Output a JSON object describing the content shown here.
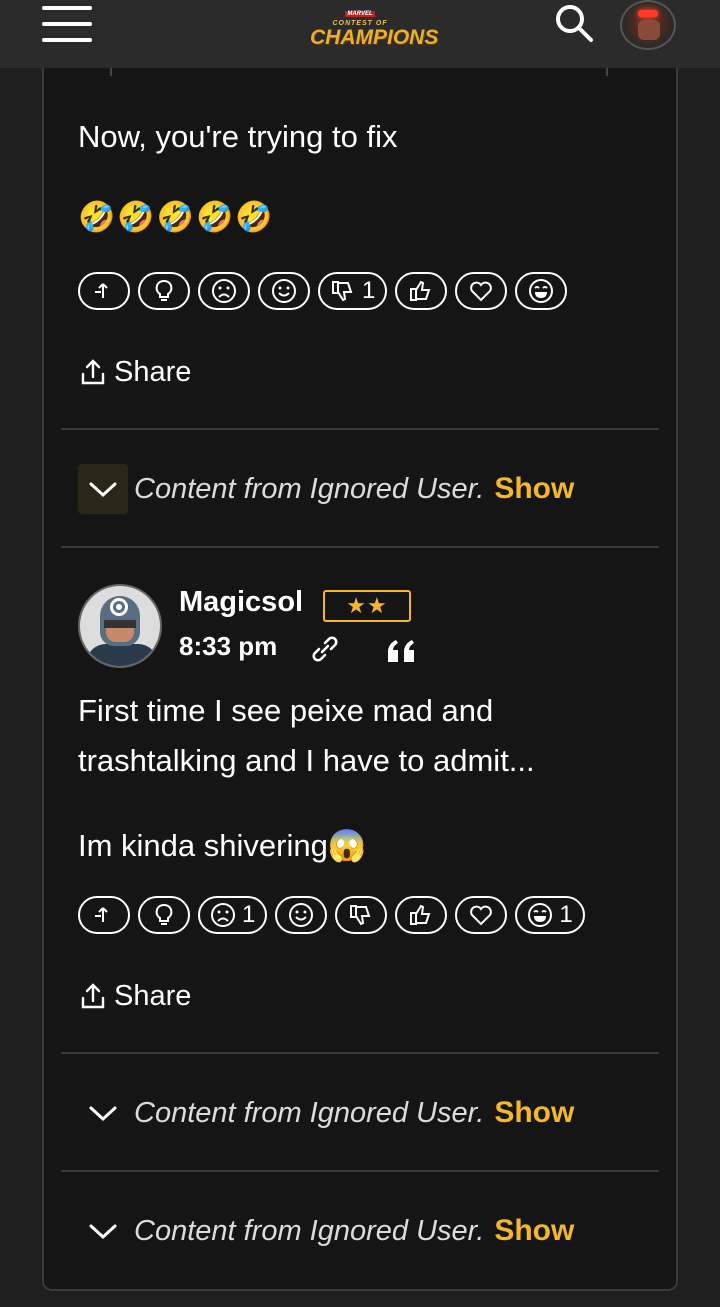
{
  "header": {
    "logo_line1": "MARVEL",
    "logo_line2": "CONTEST OF",
    "logo_line3": "CHAMPIONS"
  },
  "post1": {
    "text": "Now, you're trying to fix",
    "emoji": "🤣🤣🤣🤣🤣",
    "reactions": [
      {
        "icon": "reply-arrow-icon",
        "count": ""
      },
      {
        "icon": "lightbulb-icon",
        "count": ""
      },
      {
        "icon": "sad-face-icon",
        "count": ""
      },
      {
        "icon": "smile-face-icon",
        "count": ""
      },
      {
        "icon": "thumbs-down-icon",
        "count": "1"
      },
      {
        "icon": "thumbs-up-icon",
        "count": ""
      },
      {
        "icon": "heart-icon",
        "count": ""
      },
      {
        "icon": "laugh-face-icon",
        "count": ""
      }
    ],
    "share_label": "Share"
  },
  "ignored1": {
    "text": "Content from Ignored User.",
    "show": "Show"
  },
  "post2": {
    "username": "Magicsol",
    "rank": "★★",
    "time": "8:33 pm",
    "text_line1": "First time I see peixe mad and",
    "text_line2": "trashtalking and I have to admit...",
    "text_line3": "Im kinda shivering😱",
    "reactions": [
      {
        "icon": "reply-arrow-icon",
        "count": ""
      },
      {
        "icon": "lightbulb-icon",
        "count": ""
      },
      {
        "icon": "sad-face-icon",
        "count": "1"
      },
      {
        "icon": "smile-face-icon",
        "count": ""
      },
      {
        "icon": "thumbs-down-icon",
        "count": ""
      },
      {
        "icon": "thumbs-up-icon",
        "count": ""
      },
      {
        "icon": "heart-icon",
        "count": ""
      },
      {
        "icon": "laugh-face-icon",
        "count": "1"
      }
    ],
    "share_label": "Share"
  },
  "ignored2": {
    "text": "Content from Ignored User.",
    "show": "Show"
  },
  "ignored3": {
    "text": "Content from Ignored User.",
    "show": "Show"
  },
  "colors": {
    "accent": "#f4b72a",
    "background": "#151515",
    "topbar": "#2b2b2b"
  }
}
